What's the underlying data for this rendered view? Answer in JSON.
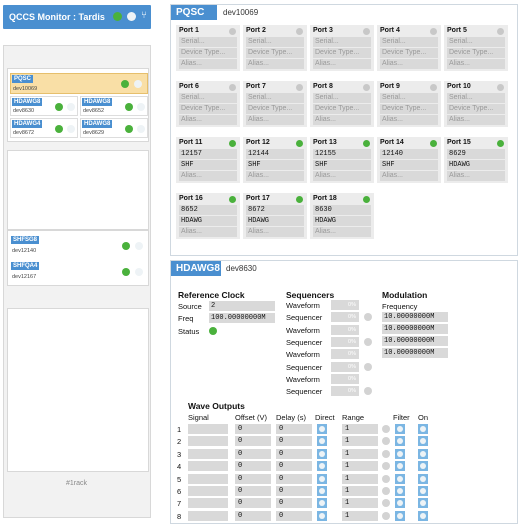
{
  "app": {
    "title": "QCCS Monitor : Tardis"
  },
  "sidebar": {
    "main_device": {
      "name": "PQSC",
      "id": "dev10069"
    },
    "instruments": [
      {
        "name": "HDAWG8",
        "id": "dev8630"
      },
      {
        "name": "HDAWG8",
        "id": "dev8652"
      },
      {
        "name": "HDAWG4",
        "id": "dev8672"
      },
      {
        "name": "HDAWG8",
        "id": "dev8629"
      }
    ],
    "rack2": [
      {
        "name": "SHFSG8",
        "id": "dev12140"
      },
      {
        "name": "SHFQA4",
        "id": "dev12167"
      }
    ],
    "footer": "#1rack"
  },
  "pqsc": {
    "title": "PQSC",
    "id": "dev10069",
    "placeholders": {
      "serial": "Serial...",
      "device_type": "Device Type...",
      "alias": "Alias..."
    },
    "ports": [
      {
        "label": "Port 1",
        "active": false,
        "serial": "",
        "type": ""
      },
      {
        "label": "Port 2",
        "active": false,
        "serial": "",
        "type": ""
      },
      {
        "label": "Port 3",
        "active": false,
        "serial": "",
        "type": ""
      },
      {
        "label": "Port 4",
        "active": false,
        "serial": "",
        "type": ""
      },
      {
        "label": "Port 5",
        "active": false,
        "serial": "",
        "type": ""
      },
      {
        "label": "Port 6",
        "active": false,
        "serial": "",
        "type": ""
      },
      {
        "label": "Port 7",
        "active": false,
        "serial": "",
        "type": ""
      },
      {
        "label": "Port 8",
        "active": false,
        "serial": "",
        "type": ""
      },
      {
        "label": "Port 9",
        "active": false,
        "serial": "",
        "type": ""
      },
      {
        "label": "Port 10",
        "active": false,
        "serial": "",
        "type": ""
      },
      {
        "label": "Port 11",
        "active": true,
        "serial": "12157",
        "type": "SHF"
      },
      {
        "label": "Port 12",
        "active": true,
        "serial": "12144",
        "type": "SHF"
      },
      {
        "label": "Port 13",
        "active": true,
        "serial": "12155",
        "type": "SHF"
      },
      {
        "label": "Port 14",
        "active": true,
        "serial": "12140",
        "type": "SHF"
      },
      {
        "label": "Port 15",
        "active": true,
        "serial": "8629",
        "type": "HDAWG"
      },
      {
        "label": "Port 16",
        "active": true,
        "serial": "8652",
        "type": "HDAWG"
      },
      {
        "label": "Port 17",
        "active": true,
        "serial": "8672",
        "type": "HDAWG"
      },
      {
        "label": "Port 18",
        "active": true,
        "serial": "8630",
        "type": "HDAWG"
      }
    ]
  },
  "hdawg": {
    "title": "HDAWG8",
    "id": "dev8630",
    "ref_clock": {
      "heading": "Reference Clock",
      "source_label": "Source",
      "source_value": "2",
      "freq_label": "Freq",
      "freq_value": "100.00000000M",
      "status_label": "Status"
    },
    "sequencers": {
      "heading": "Sequencers",
      "rows": [
        {
          "label": "Waveform",
          "value": "0%"
        },
        {
          "label": "Sequencer",
          "value": "0%"
        },
        {
          "label": "Waveform",
          "value": "0%"
        },
        {
          "label": "Sequencer",
          "value": "0%"
        },
        {
          "label": "Waveform",
          "value": "0%"
        },
        {
          "label": "Sequencer",
          "value": "0%"
        },
        {
          "label": "Waveform",
          "value": "0%"
        },
        {
          "label": "Sequencer",
          "value": "0%"
        }
      ]
    },
    "modulation": {
      "heading": "Modulation",
      "freq_label": "Frequency",
      "values": [
        "10.00000000M",
        "10.00000000M",
        "10.00000000M",
        "10.00000000M"
      ]
    },
    "wave_outputs": {
      "heading": "Wave Outputs",
      "columns": [
        "Signal",
        "Offset (V)",
        "Delay (s)",
        "Direct",
        "Range",
        "Filter",
        "On"
      ],
      "rows": [
        {
          "n": "1",
          "offset": "0",
          "delay": "0",
          "range": "1"
        },
        {
          "n": "2",
          "offset": "0",
          "delay": "0",
          "range": "1"
        },
        {
          "n": "3",
          "offset": "0",
          "delay": "0",
          "range": "1"
        },
        {
          "n": "4",
          "offset": "0",
          "delay": "0",
          "range": "1"
        },
        {
          "n": "5",
          "offset": "0",
          "delay": "0",
          "range": "1"
        },
        {
          "n": "6",
          "offset": "0",
          "delay": "0",
          "range": "1"
        },
        {
          "n": "7",
          "offset": "0",
          "delay": "0",
          "range": "1"
        },
        {
          "n": "8",
          "offset": "0",
          "delay": "0",
          "range": "1"
        }
      ]
    }
  },
  "colors": {
    "accent": "#4a8fd0",
    "ok": "#4ab13c",
    "selected": "#f9dfa6"
  }
}
